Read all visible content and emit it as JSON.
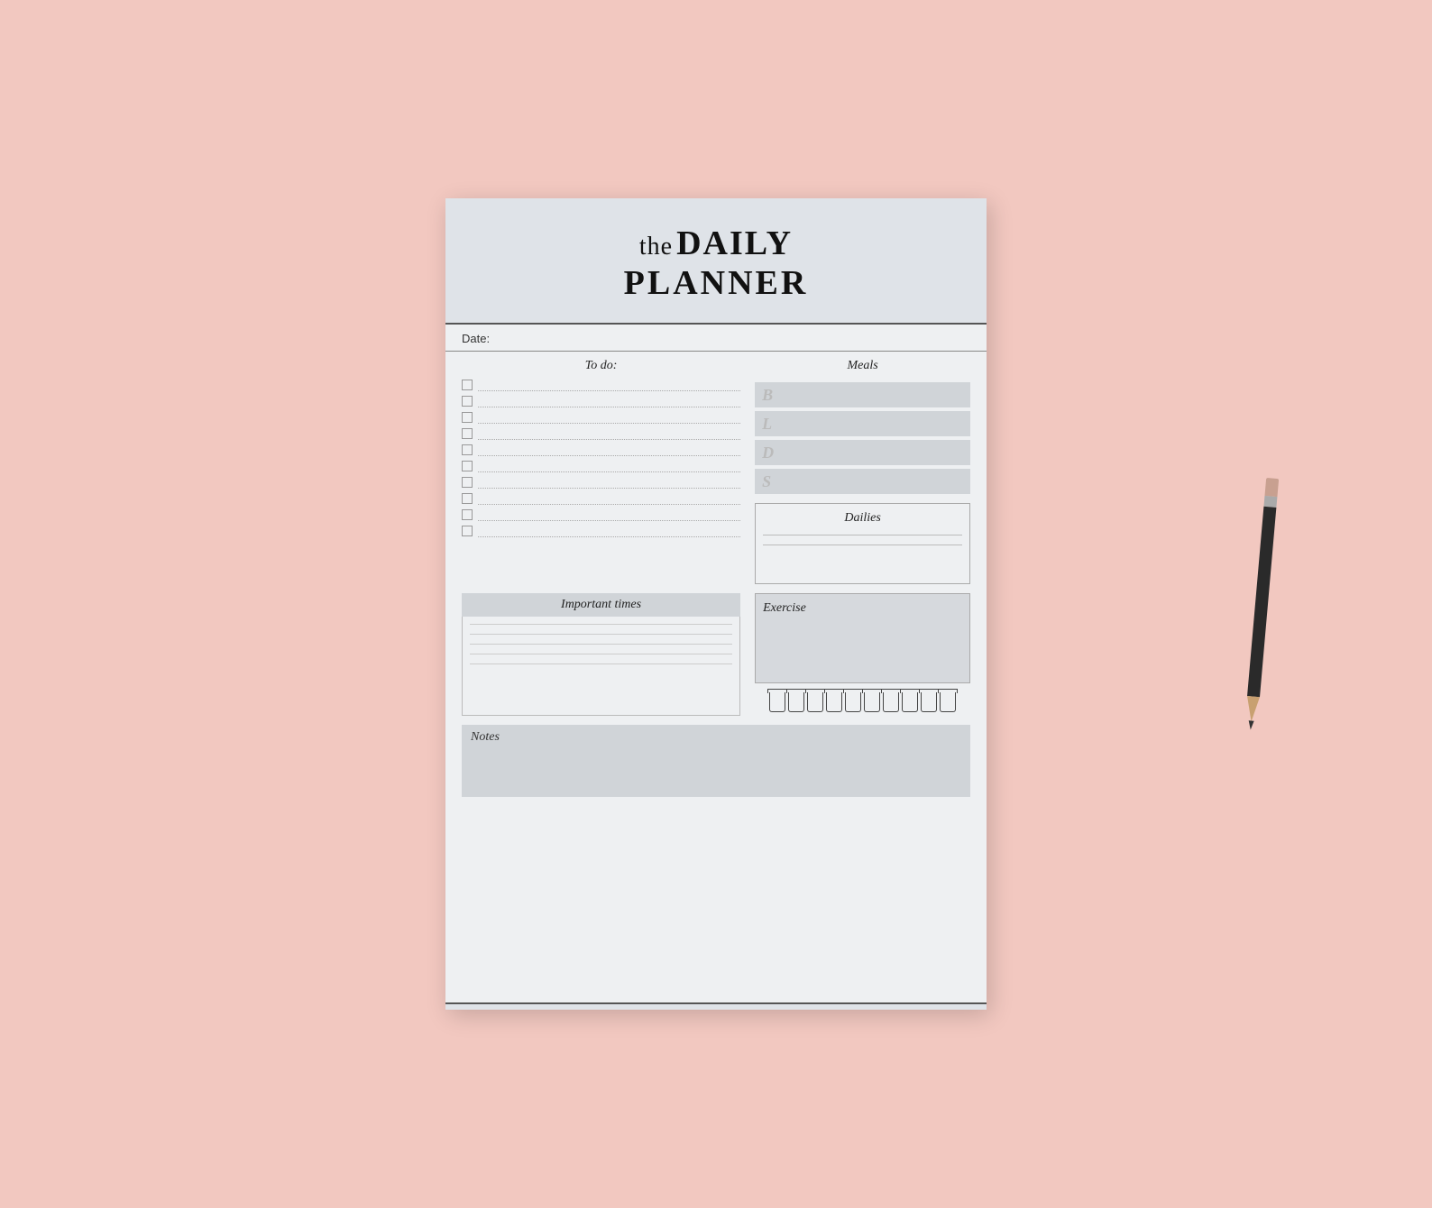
{
  "background_color": "#f2c8c0",
  "header": {
    "title_the": "the",
    "title_daily": "DAILY",
    "title_planner": "PLANNER"
  },
  "date_label": "Date:",
  "todo": {
    "section_label": "To do:",
    "items": [
      1,
      2,
      3,
      4,
      5,
      6,
      7,
      8,
      9,
      10
    ]
  },
  "meals": {
    "section_label": "Meals",
    "items": [
      {
        "letter": "B"
      },
      {
        "letter": "L"
      },
      {
        "letter": "D"
      },
      {
        "letter": "S"
      }
    ]
  },
  "dailies": {
    "label": "Dailies"
  },
  "important_times": {
    "label": "Important times"
  },
  "exercise": {
    "label": "Exercise"
  },
  "water": {
    "count": 10,
    "label": "Water glasses"
  },
  "notes": {
    "label": "Notes"
  }
}
